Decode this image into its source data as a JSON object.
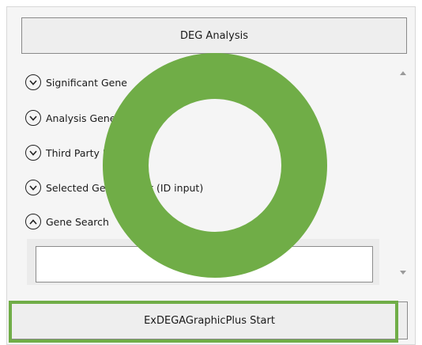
{
  "header": {
    "title": "DEG Analysis"
  },
  "sections": [
    {
      "label": "Significant Gene",
      "state": "collapsed"
    },
    {
      "label": "Analysis Gene",
      "state": "collapsed"
    },
    {
      "label": "Third Party Export",
      "state": "collapsed"
    },
    {
      "label": "Selected Gene Export (ID input)",
      "state": "collapsed"
    },
    {
      "label": "Gene Search",
      "state": "expanded"
    }
  ],
  "gene_search": {
    "value": ""
  },
  "footer": {
    "start_label": "ExDEGAGraphicPlus Start"
  },
  "annotation": {
    "color": "#70ad47"
  }
}
